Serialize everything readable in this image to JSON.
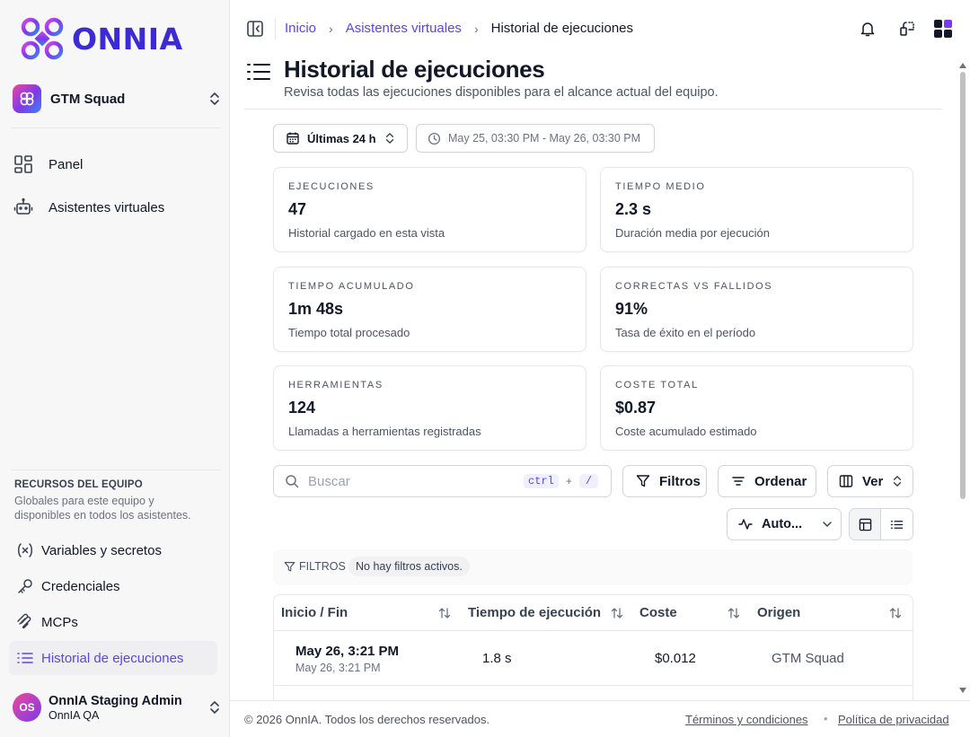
{
  "app": {
    "name": "ONNIA",
    "team": "GTM Squad"
  },
  "nav": {
    "items": [
      {
        "label": "Panel",
        "icon": "dashboard-icon"
      },
      {
        "label": "Asistentes virtuales",
        "icon": "bot-icon"
      }
    ]
  },
  "resources": {
    "title": "RECURSOS DEL EQUIPO",
    "description": "Globales para este equipo y disponibles en todos los asistentes.",
    "items": [
      {
        "label": "Variables y secretos",
        "icon": "variable-icon"
      },
      {
        "label": "Credenciales",
        "icon": "key-icon"
      },
      {
        "label": "MCPs",
        "icon": "mcp-icon"
      },
      {
        "label": "Historial de ejecuciones",
        "icon": "list-icon",
        "active": true
      }
    ]
  },
  "user": {
    "initials": "OS",
    "name": "OnnIA Staging Admin",
    "org": "OnnIA QA"
  },
  "breadcrumb": {
    "items": [
      "Inicio",
      "Asistentes virtuales"
    ],
    "current": "Historial de ejecuciones"
  },
  "page": {
    "title": "Historial de ejecuciones",
    "subtitle": "Revisa todas las ejecuciones disponibles para el alcance actual del equipo."
  },
  "range": {
    "preset": "Últimas 24 h",
    "dates": "May 25, 03:30 PM - May 26, 03:30 PM"
  },
  "stats": [
    {
      "key": "EJECUCIONES",
      "value": "47",
      "desc": "Historial cargado en esta vista"
    },
    {
      "key": "TIEMPO MEDIO",
      "value": "2.3 s",
      "desc": "Duración media por ejecución"
    },
    {
      "key": "TIEMPO ACUMULADO",
      "value": "1m 48s",
      "desc": "Tiempo total procesado"
    },
    {
      "key": "CORRECTAS VS FALLIDOS",
      "value": "91%",
      "desc": "Tasa de éxito en el período"
    },
    {
      "key": "HERRAMIENTAS",
      "value": "124",
      "desc": "Llamadas a herramientas registradas"
    },
    {
      "key": "COSTE TOTAL",
      "value": "$0.87",
      "desc": "Coste acumulado estimado"
    }
  ],
  "toolbar": {
    "search_placeholder": "Buscar",
    "shortcut_ctrl": "ctrl",
    "shortcut_plus": "+",
    "shortcut_key": "/",
    "filters_label": "Filtros",
    "sort_label": "Ordenar",
    "view_label": "Ver",
    "auto_label": "Auto..."
  },
  "filters": {
    "label": "FILTROS",
    "status": "No hay filtros activos."
  },
  "table": {
    "columns": [
      "Inicio / Fin",
      "Tiempo de ejecución",
      "Coste",
      "Origen"
    ],
    "rows": [
      {
        "start": "May 26, 3:21 PM",
        "end": "May 26, 3:21 PM",
        "duration": "1.8 s",
        "cost": "$0.012",
        "origin": "GTM Squad"
      }
    ]
  },
  "footer": {
    "copyright": "© 2026 OnnIA. Todos los derechos reservados.",
    "terms": "Términos y condiciones",
    "separator": "•",
    "privacy": "Política de privacidad"
  },
  "colors": {
    "accent": "#5b46e6",
    "brand": "#3b2ad6"
  }
}
